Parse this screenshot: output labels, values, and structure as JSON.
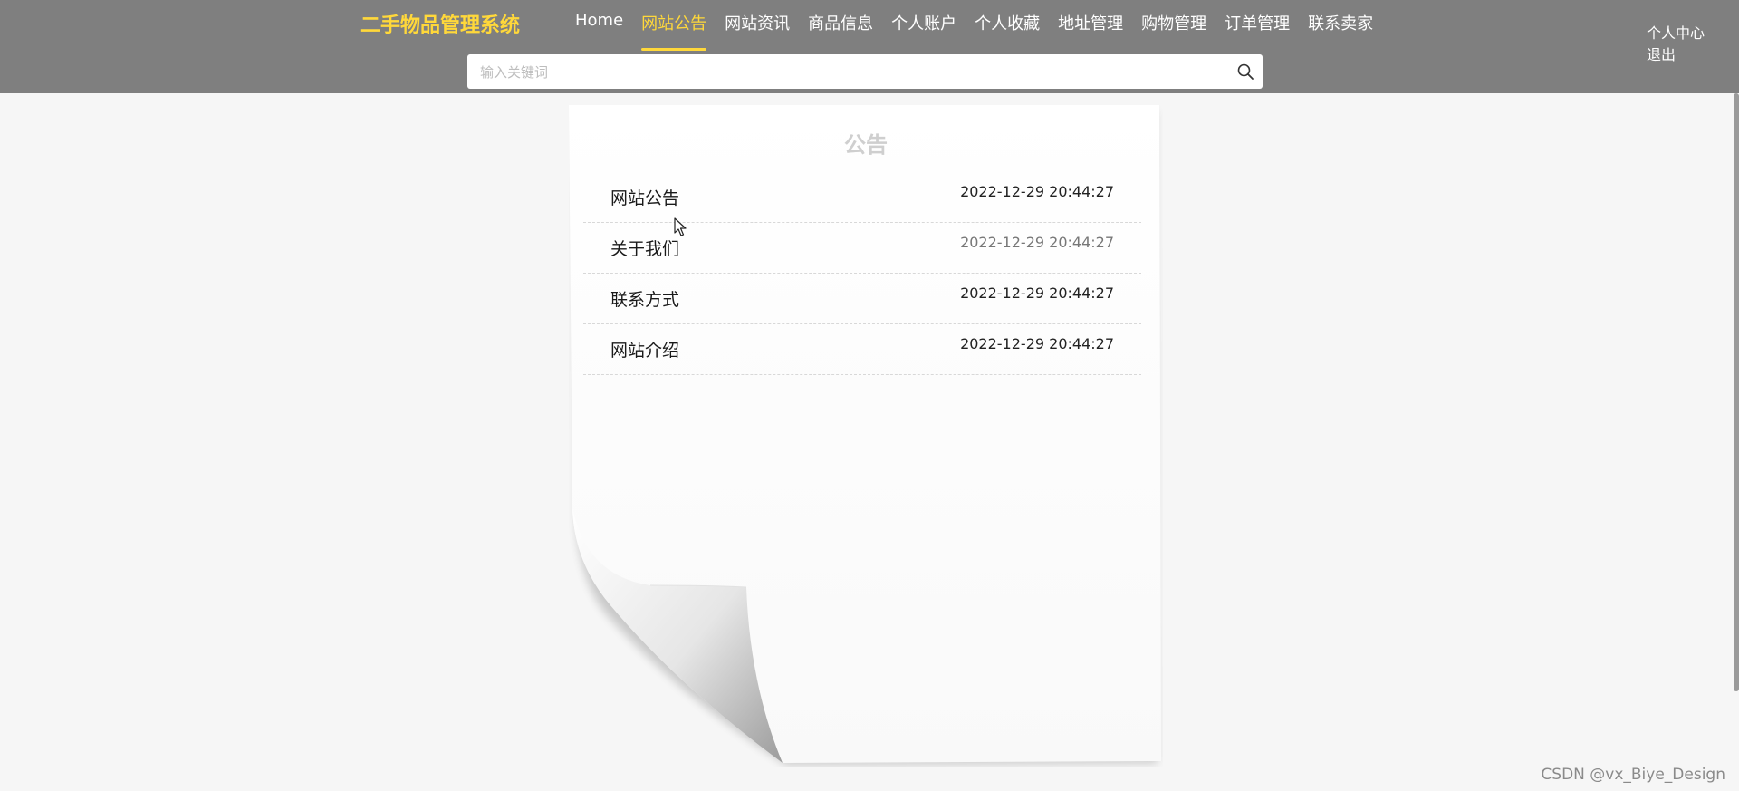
{
  "brand": {
    "title": "二手物品管理系统"
  },
  "nav": {
    "items": [
      {
        "label": "Home",
        "active": false
      },
      {
        "label": "网站公告",
        "active": true
      },
      {
        "label": "网站资讯",
        "active": false
      },
      {
        "label": "商品信息",
        "active": false
      },
      {
        "label": "个人账户",
        "active": false
      },
      {
        "label": "个人收藏",
        "active": false
      },
      {
        "label": "地址管理",
        "active": false
      },
      {
        "label": "购物管理",
        "active": false
      },
      {
        "label": "订单管理",
        "active": false
      },
      {
        "label": "联系卖家",
        "active": false
      }
    ]
  },
  "user": {
    "center_label": "个人中心",
    "logout_label": "退出"
  },
  "search": {
    "placeholder": "输入关键词",
    "value": "",
    "icon": "search-icon"
  },
  "notices": {
    "heading": "公告",
    "items": [
      {
        "title": "网站公告",
        "date": "2022-12-29 20:44:27"
      },
      {
        "title": "关于我们",
        "date": "2022-12-29 20:44:27"
      },
      {
        "title": "联系方式",
        "date": "2022-12-29 20:44:27"
      },
      {
        "title": "网站介绍",
        "date": "2022-12-29 20:44:27"
      }
    ]
  },
  "watermark": "CSDN @vx_Biye_Design",
  "colors": {
    "header_bg": "#7f7f7f",
    "accent": "#ffd83a",
    "page_bg": "#f6f6f6"
  }
}
